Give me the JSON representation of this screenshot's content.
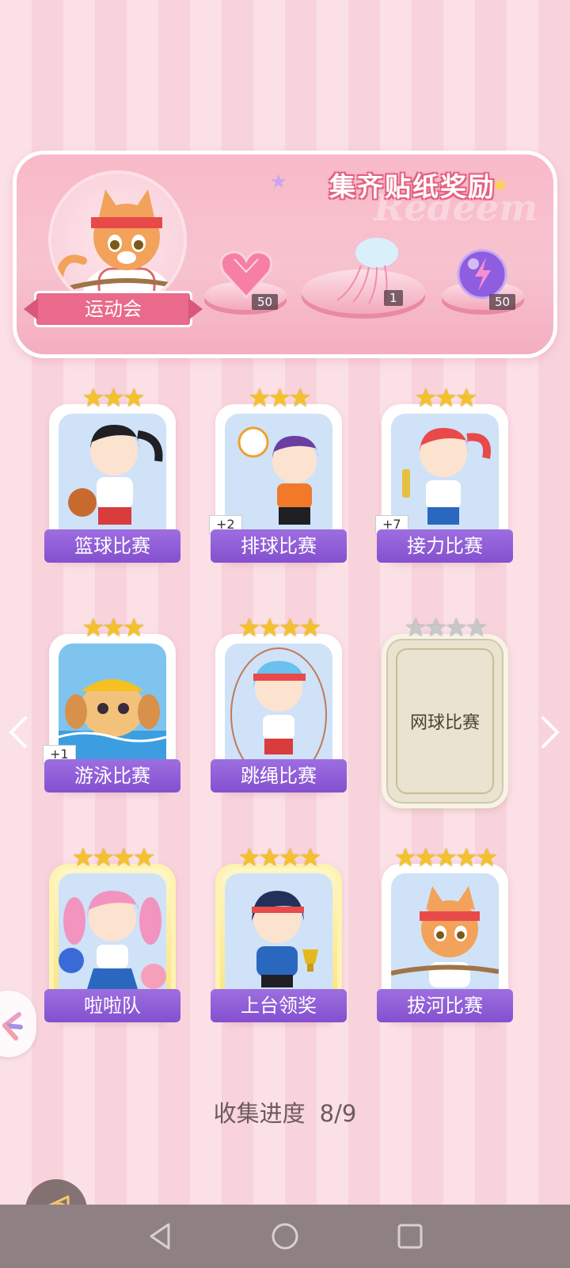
{
  "banner": {
    "title": "集齐贴纸奖励",
    "watermark": "Redeem",
    "event_name": "运动会",
    "rewards": [
      {
        "icon": "pink-diamond-heart-icon",
        "count": "50"
      },
      {
        "icon": "jellyfish-decoration-icon",
        "count": "1"
      },
      {
        "icon": "purple-energy-orb-icon",
        "count": "50"
      }
    ]
  },
  "cards": [
    {
      "label": "篮球比赛",
      "stars": 3,
      "max_stars": 3,
      "collected": true,
      "dup": ""
    },
    {
      "label": "排球比赛",
      "stars": 3,
      "max_stars": 3,
      "collected": true,
      "dup": "+2"
    },
    {
      "label": "接力比赛",
      "stars": 3,
      "max_stars": 3,
      "collected": true,
      "dup": "+7"
    },
    {
      "label": "游泳比赛",
      "stars": 3,
      "max_stars": 3,
      "collected": true,
      "dup": "+1"
    },
    {
      "label": "跳绳比赛",
      "stars": 4,
      "max_stars": 4,
      "collected": true,
      "dup": ""
    },
    {
      "label": "网球比赛",
      "stars": 0,
      "max_stars": 4,
      "collected": false,
      "dup": ""
    },
    {
      "label": "啦啦队",
      "stars": 4,
      "max_stars": 4,
      "collected": true,
      "dup": "",
      "gold": true
    },
    {
      "label": "上台领奖",
      "stars": 4,
      "max_stars": 4,
      "collected": true,
      "dup": "",
      "gold": true
    },
    {
      "label": "拔河比赛",
      "stars": 5,
      "max_stars": 5,
      "collected": true,
      "dup": ""
    }
  ],
  "progress": {
    "label": "收集进度",
    "value": "8/9"
  },
  "colors": {
    "accent_purple": "#8450cf",
    "banner_pink": "#f7c3cf",
    "star_gold": "#f5c12a"
  }
}
